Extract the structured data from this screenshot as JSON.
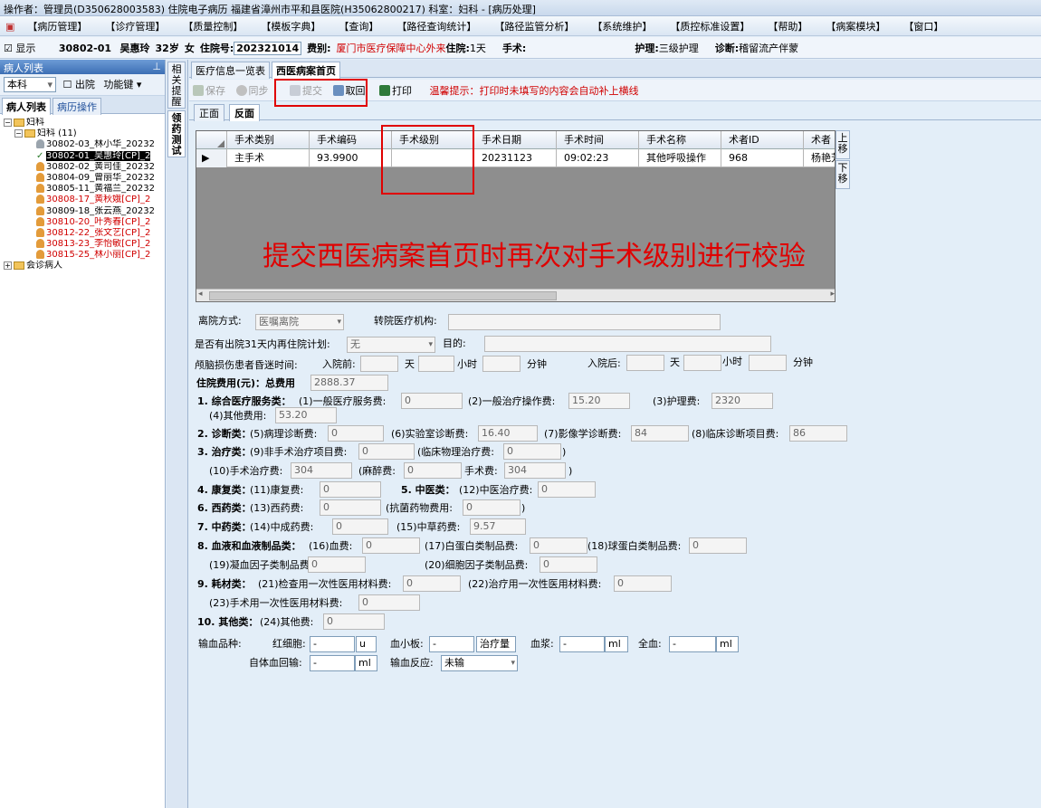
{
  "titlebar": {
    "text": "操作者：管理员(D350628003583) 住院电子病历 福建省漳州市平和县医院(H35062800217) 科室：妇科 - [病历处理]"
  },
  "menu": [
    "【病历管理】",
    "【诊疗管理】",
    "【质量控制】",
    "【模板字典】",
    "【查询】",
    "【路径查询统计】",
    "【路径监管分析】",
    "【系统维护】",
    "【质控标准设置】",
    "【帮助】",
    "【病案模块】",
    "【窗口】"
  ],
  "patient": {
    "show_label": "显示",
    "bed": "30802-01",
    "name": "吴惠玲",
    "age": "32岁",
    "sex": "女",
    "inpatient_no_label": "住院号:",
    "inpatient_no": "202321014",
    "fee_type_label": "费别:",
    "fee_type": "厦门市医疗保障中心外来",
    "stay_label": "住院:",
    "stay": "1天",
    "surgery_label": "手术:",
    "nursing_label": "护理:",
    "nursing": "三级护理",
    "diagnosis_label": "诊断:",
    "diagnosis": "稽留流产伴蒙"
  },
  "left": {
    "header": "病人列表",
    "pin": "⊥",
    "dept_select": "本科",
    "discharged_label": "出院",
    "function_key": "功能键",
    "tabs": [
      "病人列表",
      "病历操作"
    ],
    "tree_root": "妇科",
    "tree_group": "妇科 (11)",
    "patients": [
      {
        "text": "30802-03_林小华_20232",
        "style": "gray"
      },
      {
        "text": "30802-01_吴惠玲[CP]_2",
        "style": "selected"
      },
      {
        "text": "30802-02_黄司佳_20232",
        "style": "normal"
      },
      {
        "text": "30804-09_曾丽华_20232",
        "style": "normal"
      },
      {
        "text": "30805-11_黄福兰_20232",
        "style": "normal"
      },
      {
        "text": "30808-17_黄秋娥[CP]_2",
        "style": "red"
      },
      {
        "text": "30809-18_张云燕_20232",
        "style": "normal"
      },
      {
        "text": "30810-20_叶秀春[CP]_2",
        "style": "red"
      },
      {
        "text": "30812-22_张文艺[CP]_2",
        "style": "red"
      },
      {
        "text": "30813-23_李怡敏[CP]_2",
        "style": "red"
      },
      {
        "text": "30815-25_林小丽[CP]_2",
        "style": "red"
      }
    ],
    "consult": "会诊病人"
  },
  "side_tabs": [
    "相关提醒",
    "领药测试"
  ],
  "doc_tabs": [
    "医疗信息一览表",
    "西医病案首页"
  ],
  "toolbar": {
    "save": "保存",
    "sync": "同步",
    "submit": "提交",
    "retract": "取回",
    "print": "打印",
    "tip": "温馨提示：打印时未填写的内容会自动补上横线"
  },
  "sub_tabs": [
    "正面",
    "反面"
  ],
  "grid": {
    "headers": [
      "手术类别",
      "手术编码",
      "手术级别",
      "手术日期",
      "手术时间",
      "手术名称",
      "术者ID",
      "术者"
    ],
    "rows": [
      [
        "主手术",
        "93.9900",
        "",
        "20231123",
        "09:02:23",
        "其他呼吸操作",
        "968",
        "杨艳芳"
      ]
    ],
    "row_marker": "▶",
    "move_up": "上移",
    "move_down": "下移"
  },
  "annotation": "提交西医病案首页时再次对手术级别进行校验",
  "form": {
    "discharge_mode_label": "离院方式:",
    "discharge_mode": "医嘱离院",
    "transfer_org_label": "转院医疗机构:",
    "readmit_label": "是否有出院31天内再住院计划:",
    "readmit": "无",
    "purpose_label": "目的:",
    "coma_label": "颅脑损伤患者昏迷时间:",
    "before_label": "入院前:",
    "after_label": "入院后:",
    "day": "天",
    "hour": "小时",
    "minute": "分钟",
    "total_label": "住院费用(元)：总费用",
    "total": "2888.37",
    "c1": "1. 综合医疗服务类：",
    "f1_label": "(1)一般医疗服务费:",
    "f1": "0",
    "f2_label": "(2)一般治疗操作费:",
    "f2": "15.20",
    "f3_label": "(3)护理费:",
    "f3": "2320",
    "f4_label": "(4)其他费用:",
    "f4": "53.20",
    "c2": "2. 诊断类：",
    "f5_label": "(5)病理诊断费:",
    "f5": "0",
    "f6_label": "(6)实验室诊断费:",
    "f6": "16.40",
    "f7_label": "(7)影像学诊断费:",
    "f7": "84",
    "f8_label": "(8)临床诊断项目费:",
    "f8": "86",
    "c3": "3. 治疗类：",
    "f9_label": "(9)非手术治疗项目费:",
    "f9": "0",
    "f9a_label": "(临床物理治疗费:",
    "f9a": "0",
    "close_paren": ")",
    "f10_label": "(10)手术治疗费:",
    "f10": "304",
    "f10a_label": "(麻醉费:",
    "f10a": "0",
    "f10b_label": "手术费:",
    "f10b": "304",
    "c4": "4. 康复类：",
    "f11_label": "(11)康复费:",
    "f11": "0",
    "c5": "5. 中医类：",
    "f12_label": "(12)中医治疗费:",
    "f12": "0",
    "c6": "6. 西药类：",
    "f13_label": "(13)西药费:",
    "f13": "0",
    "f13a_label": "(抗菌药物费用:",
    "f13a": "0",
    "c7": "7. 中药类：",
    "f14_label": "(14)中成药费:",
    "f14": "0",
    "f15_label": "(15)中草药费:",
    "f15": "9.57",
    "c8": "8. 血液和血液制品类：",
    "f16_label": "(16)血费:",
    "f16": "0",
    "f17_label": "(17)白蛋白类制品费:",
    "f17": "0",
    "f18_label": "(18)球蛋白类制品费:",
    "f18": "0",
    "f19_label": "(19)凝血因子类制品费:",
    "f19": "0",
    "f20_label": "(20)细胞因子类制品费:",
    "f20": "0",
    "c9": "9. 耗材类：",
    "f21_label": "(21)检查用一次性医用材料费:",
    "f21": "0",
    "f22_label": "(22)治疗用一次性医用材料费:",
    "f22": "0",
    "f23_label": "(23)手术用一次性医用材料费:",
    "f23": "0",
    "c10": "10. 其他类：",
    "f24_label": "(24)其他费:",
    "f24": "0",
    "transfusion_label": "输血品种:",
    "rbc_label": "红细胞:",
    "rbc": "-",
    "rbc_unit": "u",
    "plt_label": "血小板:",
    "plt": "-",
    "plt_unit": "治疗量",
    "plasma_label": "血浆:",
    "plasma": "-",
    "plasma_unit": "ml",
    "whole_label": "全血:",
    "whole": "-",
    "whole_unit": "ml",
    "auto_label": "自体血回输:",
    "auto": "-",
    "auto_unit": "ml",
    "reaction_label": "输血反应:",
    "reaction": "未输"
  }
}
